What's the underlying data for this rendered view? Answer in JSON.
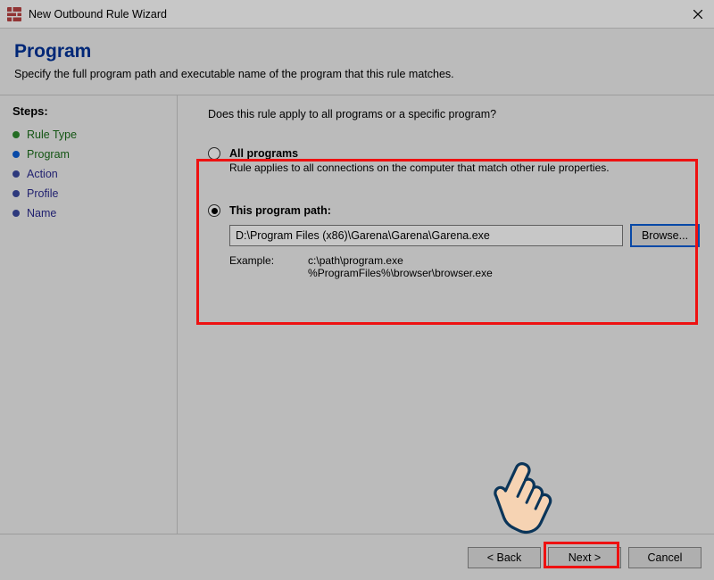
{
  "window": {
    "title": "New Outbound Rule Wizard"
  },
  "header": {
    "title": "Program",
    "subtitle": "Specify the full program path and executable name of the program that this rule matches."
  },
  "sidebar": {
    "title": "Steps:",
    "items": [
      {
        "label": "Rule Type",
        "state": "done"
      },
      {
        "label": "Program",
        "state": "done"
      },
      {
        "label": "Action",
        "state": "pending"
      },
      {
        "label": "Profile",
        "state": "pending"
      },
      {
        "label": "Name",
        "state": "pending"
      }
    ]
  },
  "main": {
    "prompt": "Does this rule apply to all programs or a specific program?",
    "all_programs": {
      "label": "All programs",
      "desc": "Rule applies to all connections on the computer that match other rule properties."
    },
    "this_program": {
      "label": "This program path:",
      "path_value": "D:\\Program Files (x86)\\Garena\\Garena\\Garena.exe",
      "browse_label": "Browse...",
      "example_label": "Example:",
      "example_lines": "c:\\path\\program.exe\n%ProgramFiles%\\browser\\browser.exe"
    }
  },
  "buttons": {
    "back": "< Back",
    "next": "Next >",
    "cancel": "Cancel"
  },
  "selection": {
    "program_scope": "this_program"
  }
}
